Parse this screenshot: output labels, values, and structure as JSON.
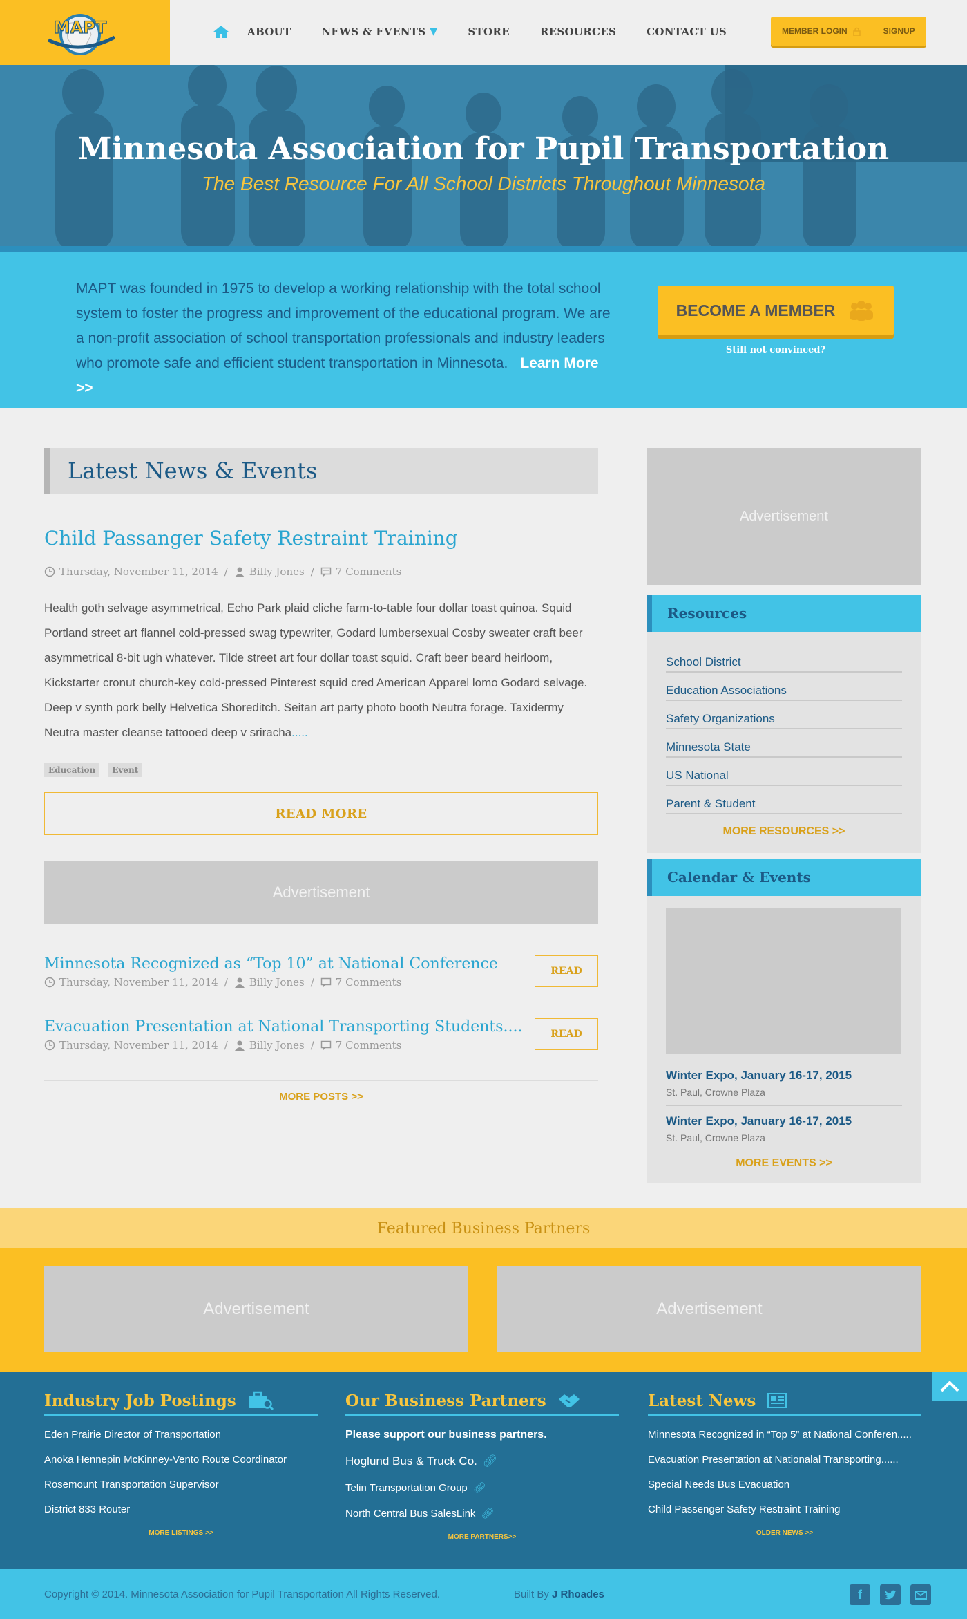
{
  "logo": {
    "text": "MAPT"
  },
  "nav": {
    "items": [
      "ABOUT",
      "NEWS & EVENTS",
      "STORE",
      "RESOURCES",
      "CONTACT US"
    ],
    "login": "MEMBER LOGIN",
    "signup": "SIGNUP"
  },
  "hero": {
    "title": "Minnesota Association for Pupil Transportation",
    "subtitle": "The Best Resource For All School Districts Throughout Minnesota"
  },
  "intro": {
    "text": "MAPT was founded in 1975 to develop a working relationship with the total school system to foster the progress and improvement of the educational program. We are a non-profit association of school transportation professionals and industry leaders who promote safe and efficient student transportation in Minnesota.",
    "learn_more": "Learn More >>",
    "become": "BECOME A MEMBER",
    "convinced": "Still not convinced?"
  },
  "news": {
    "heading": "Latest News & Events",
    "featured": {
      "title": "Child Passanger Safety Restraint Training",
      "date": "Thursday, November 11, 2014",
      "author": "Billy Jones",
      "comments": "7 Comments",
      "body": "Health goth selvage asymmetrical, Echo Park plaid cliche farm-to-table four dollar toast quinoa. Squid Portland street art flannel cold-pressed swag typewriter, Godard lumbersexual Cosby sweater craft beer asymmetrical 8-bit ugh whatever. Tilde street art four dollar toast squid. Craft beer beard heirloom, Kickstarter cronut church-key cold-pressed Pinterest squid cred American Apparel lomo Godard selvage. Deep v synth pork belly Helvetica Shoreditch. Seitan art party photo booth Neutra forage. Taxidermy Neutra master cleanse tattooed deep v sriracha",
      "dots": ".....",
      "tags": [
        "Education",
        "Event"
      ],
      "read_more": "READ MORE"
    },
    "ad": "Advertisement",
    "posts": [
      {
        "title": "Minnesota Recognized as “Top 10” at National Conference",
        "date": "Thursday, November 11, 2014",
        "author": "Billy Jones",
        "comments": "7 Comments",
        "read": "READ"
      },
      {
        "title": "Evacuation Presentation at National Transporting Students....",
        "date": "Thursday, November 11, 2014",
        "author": "Billy Jones",
        "comments": "7 Comments",
        "read": "READ"
      }
    ],
    "more_posts": "MORE POSTS >>"
  },
  "sidebar": {
    "ad": "Advertisement",
    "resources": {
      "heading": "Resources",
      "items": [
        "School District",
        "Education Associations",
        "Safety Organizations",
        "Minnesota State",
        "US National",
        "Parent & Student"
      ],
      "more": "MORE RESOURCES >>"
    },
    "calendar": {
      "heading": "Calendar & Events",
      "events": [
        {
          "title": "Winter Expo, January 16-17, 2015",
          "location": "St. Paul, Crowne Plaza"
        },
        {
          "title": "Winter Expo, January 16-17, 2015",
          "location": "St. Paul, Crowne Plaza"
        }
      ],
      "more": "MORE EVENTS >>"
    }
  },
  "featured_partners": {
    "heading": "Featured Business Partners",
    "ads": [
      "Advertisement",
      "Advertisement"
    ]
  },
  "footer": {
    "jobs": {
      "heading": "Industry Job Postings",
      "items": [
        "Eden Prairie Director of Transportation",
        "Anoka Hennepin McKinney-Vento Route Coordinator",
        "Rosemount Transportation Supervisor",
        "District 833 Router"
      ],
      "more": "MORE LISTINGS >>"
    },
    "partners": {
      "heading": "Our Business Partners",
      "intro": "Please support our business partners.",
      "items": [
        "Hoglund Bus & Truck Co.",
        "Telin Transportation Group",
        "North Central Bus SalesLink"
      ],
      "more": "MORE PARTNERS>>"
    },
    "latest": {
      "heading": "Latest News",
      "items": [
        "Minnesota Recognized in “Top 5” at National Conferen.....",
        "Evacuation Presentation at Nationalal Transporting......",
        "Special Needs Bus Evacuation",
        "Child Passenger Safety Restraint Training"
      ],
      "more": "OLDER NEWS >>"
    }
  },
  "bottom": {
    "copyright": "Copyright © 2014. Minnesota Association for Pupil Transportation All Rights Reserved.",
    "built_by": "Built By",
    "builder": "J Rhoades",
    "social": [
      "facebook-icon",
      "twitter-icon",
      "mail-icon"
    ]
  },
  "colors": {
    "yellow": "#fbbf23",
    "cyan": "#42c3e6",
    "navy": "#1c5a86",
    "footer": "#236f95"
  }
}
